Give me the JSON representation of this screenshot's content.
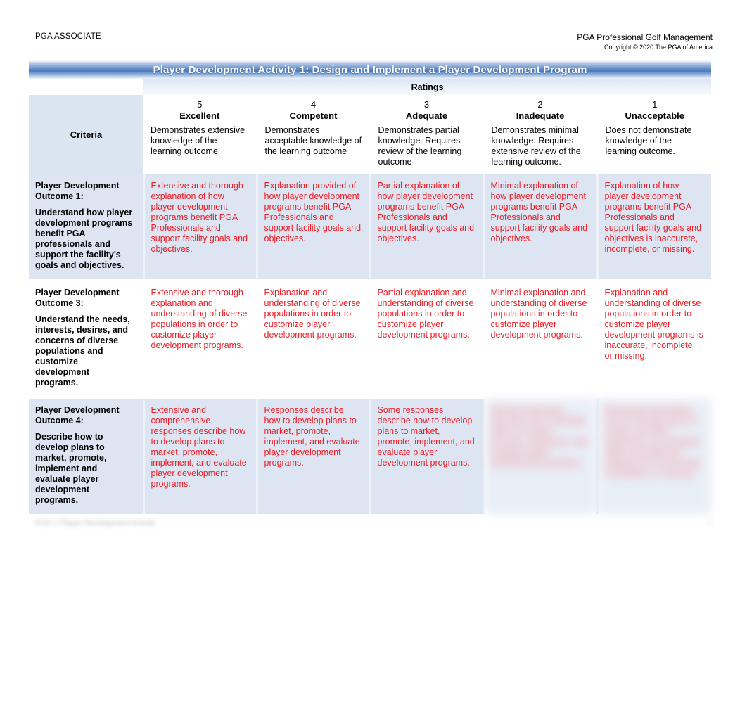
{
  "header": {
    "left_label": "PGA ASSOCIATE",
    "right_title": "PGA Professional Golf Management",
    "right_copyright": "Copyright © 2020 The PGA of America"
  },
  "rubric": {
    "title": "Player Development Activity 1: Design and Implement a Player Development Program",
    "ratings_label": "Ratings",
    "criteria_header": "Criteria",
    "columns": [
      {
        "score": "5",
        "level": "Excellent",
        "description": "Demonstrates extensive knowledge of the learning outcome"
      },
      {
        "score": "4",
        "level": "Competent",
        "description": "Demonstrates acceptable knowledge of the learning outcome"
      },
      {
        "score": "3",
        "level": "Adequate",
        "description": "Demonstrates partial knowledge. Requires review of the learning outcome"
      },
      {
        "score": "2",
        "level": "Inadequate",
        "description": "Demonstrates minimal knowledge. Requires extensive review of the learning outcome."
      },
      {
        "score": "1",
        "level": "Unacceptable",
        "description": "Does not demonstrate knowledge of the learning outcome."
      }
    ],
    "rows": [
      {
        "criterion_title": "Player Development Outcome 1:",
        "criterion_text": "Understand how player development programs benefit PGA professionals and support the facility's goals and objectives.",
        "cells": [
          "Extensive and thorough explanation of how player development programs benefit PGA Professionals and support facility goals and objectives.",
          "Explanation provided of how player development programs benefit PGA Professionals and support facility goals and objectives.",
          "Partial explanation of how player development programs benefit PGA Professionals and support facility goals and objectives.",
          "Minimal explanation of how player development programs benefit PGA Professionals and support facility goals and objectives.",
          "Explanation of how player development programs benefit PGA Professionals and support facility goals and objectives is inaccurate, incomplete, or missing."
        ],
        "cells_blurred": [
          false,
          false,
          false,
          false,
          false
        ]
      },
      {
        "criterion_title": "Player Development Outcome 3:",
        "criterion_text": "Understand the needs, interests, desires, and concerns of diverse populations and customize development programs.",
        "cells": [
          "Extensive and thorough explanation and understanding of diverse populations in order to customize player development programs.",
          "Explanation and understanding of diverse populations in order to customize player development programs.",
          "Partial explanation and understanding of diverse populations in order to customize player development programs.",
          "Minimal explanation and understanding of diverse populations in order to customize player development programs.",
          "Explanation and understanding of diverse populations in order to customize player development programs is inaccurate, incomplete, or missing."
        ],
        "cells_blurred": [
          false,
          false,
          false,
          false,
          false
        ]
      },
      {
        "criterion_title": "Player Development Outcome 4:",
        "criterion_text": "Describe how to develop plans to market, promote, implement and evaluate player development programs.",
        "cells": [
          "Extensive and comprehensive responses describe how to develop plans to market, promote, implement, and evaluate player development programs.",
          "Responses describe how to develop plans to market, promote, implement, and evaluate player development programs.",
          "Some responses describe how to develop plans to market, promote, implement, and evaluate player development programs.",
          "Minimal responses describe how to develop plans to market, promote, implement, and evaluate player development programs.",
          "Responses describing how to develop plans to market, promote, implement, and evaluate player development programs are inaccurate, incomplete, or missing."
        ],
        "cells_blurred": [
          false,
          false,
          false,
          true,
          true
        ]
      }
    ]
  },
  "footer": {
    "left_text": "PGA 1 Player Development Activity",
    "right_text": "1"
  }
}
